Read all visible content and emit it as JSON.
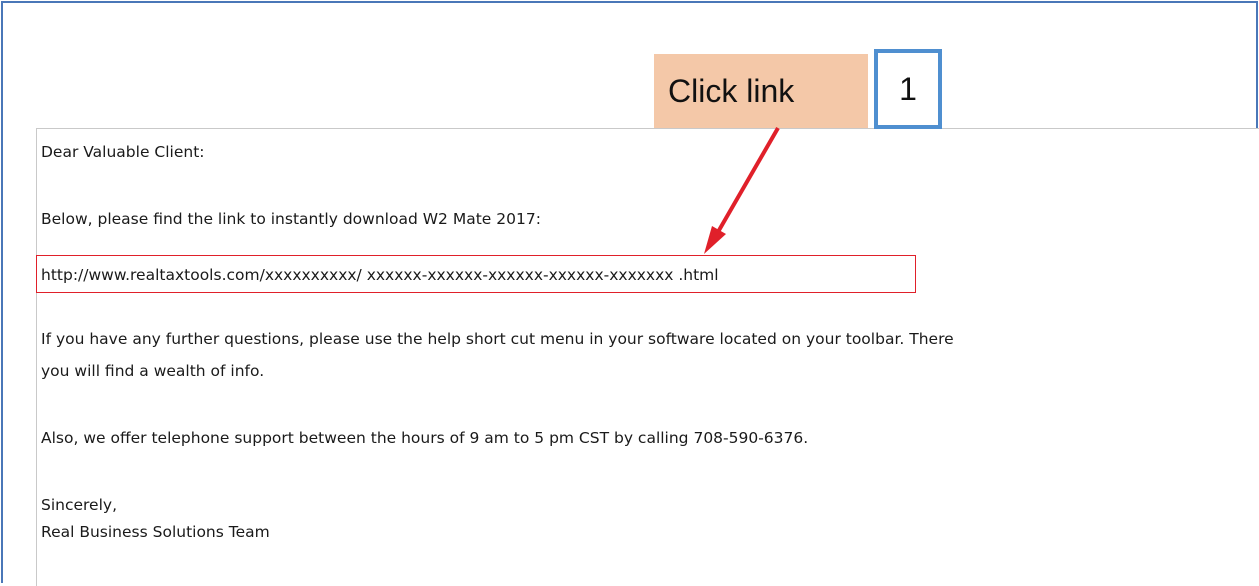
{
  "email": {
    "greeting": "Dear Valuable Client:",
    "intro": "Below, please find the link to instantly download W2 Mate 2017:",
    "link": "http://www.realtaxtools.com/xxxxxxxxxx/ xxxxxx-xxxxxx-xxxxxx-xxxxxx-xxxxxxx .html",
    "para1_line1": "If you have any further questions, please use the help short cut menu in your software located on your toolbar.  There",
    "para1_line2": "you will find a wealth of info.",
    "para2": "Also, we offer telephone support between the hours of 9 am to 5 pm CST by calling 708-590-6376.",
    "closing": "Sincerely,",
    "signature": "Real Business Solutions Team"
  },
  "annotation": {
    "callout_label": "Click link",
    "step_number": "1",
    "callout_color": "#f4c8a8",
    "step_border_color": "#4f8fd0",
    "arrow_color": "#e0202a",
    "highlight_color": "#e0202a"
  }
}
